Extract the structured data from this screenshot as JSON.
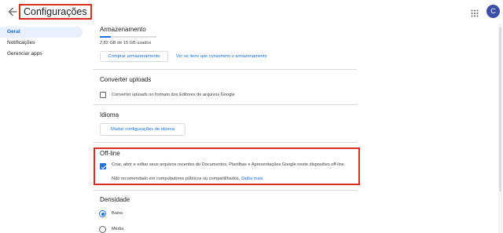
{
  "header": {
    "title": "Configurações",
    "avatar_letter": "C"
  },
  "sidebar": {
    "items": [
      {
        "label": "Geral",
        "active": true
      },
      {
        "label": "Notificações",
        "active": false
      },
      {
        "label": "Gerenciar apps",
        "active": false
      }
    ]
  },
  "storage": {
    "title": "Armazenamento",
    "usage": "2,82 GB de 15 GB usados",
    "usage_fraction": 0.19,
    "buy_button": "Comprar armazenamento",
    "view_link": "Ver os itens que consomem o armazenamento"
  },
  "convert": {
    "title": "Converter uploads",
    "checkbox_label": "Converter uploads no formato dos Editores de arquivos Google",
    "checked": false
  },
  "language": {
    "title": "Idioma",
    "button": "Mudar configurações de idioma"
  },
  "offline": {
    "title": "Off-line",
    "checkbox_label": "Criar, abrir e editar seus arquivos recentes do Documentos, Planilhas e Apresentações Google neste dispositivo off-line",
    "checked": true,
    "note": "Não recomendado em computadores públicos ou compartilhados.",
    "learn_more": "Saiba mais"
  },
  "density": {
    "title": "Densidade",
    "options": [
      {
        "label": "Baixa",
        "selected": true
      },
      {
        "label": "Média",
        "selected": false
      }
    ]
  },
  "colors": {
    "accent": "#1a73e8",
    "highlight": "#d93025",
    "active_nav_bg": "#e8f0fe"
  }
}
